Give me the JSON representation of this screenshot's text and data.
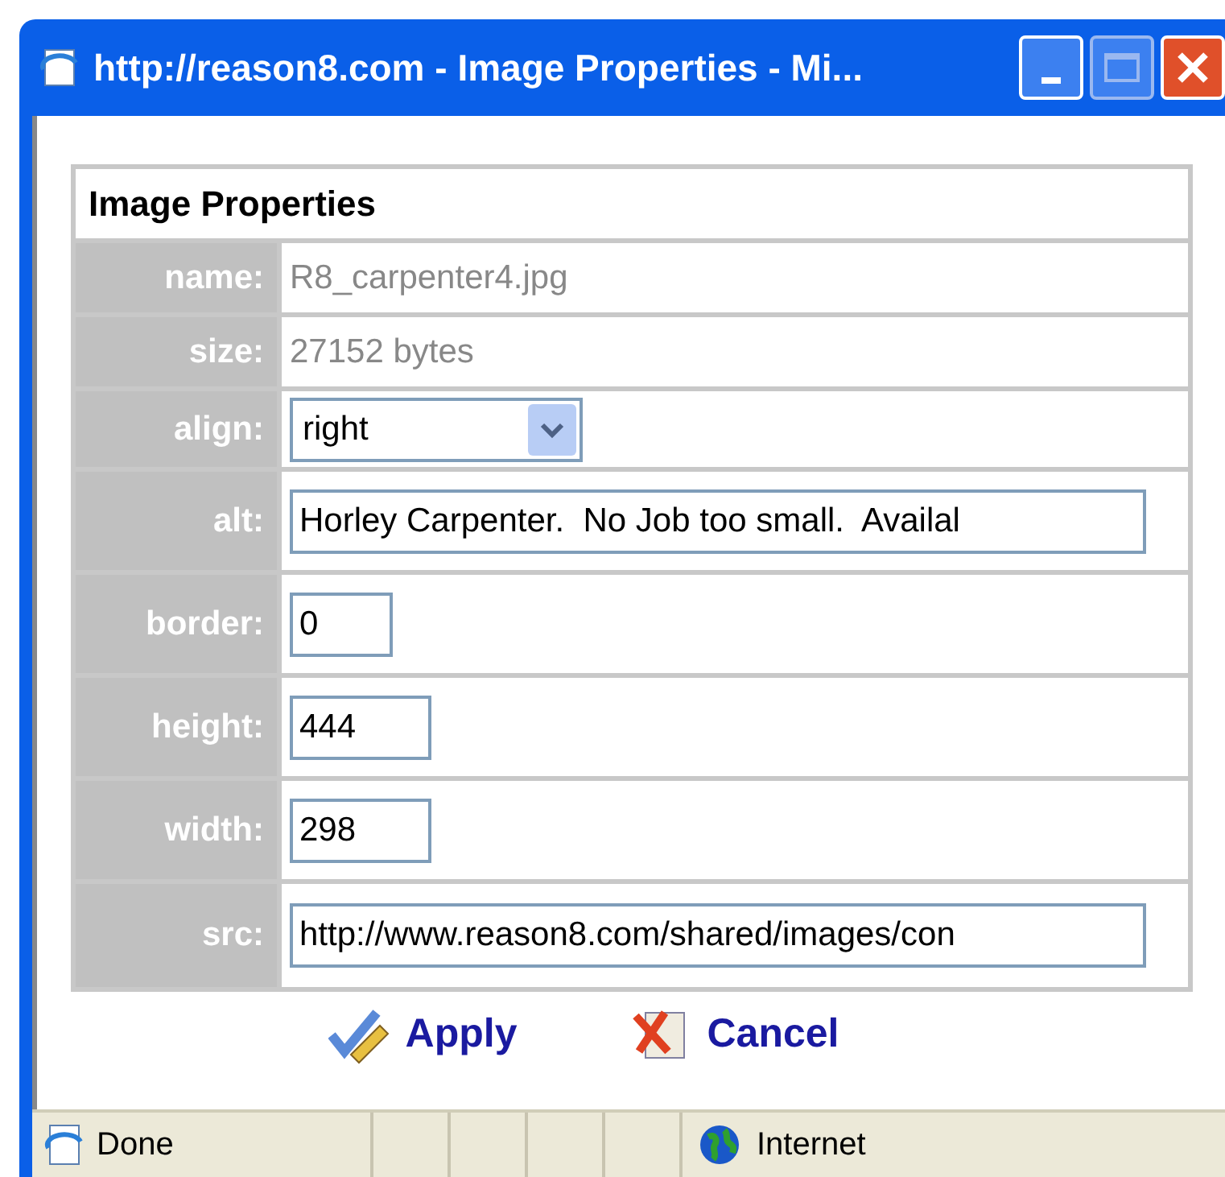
{
  "window": {
    "title": "http://reason8.com - Image Properties - Mi..."
  },
  "panel": {
    "title": "Image Properties",
    "rows": [
      {
        "label": "name:",
        "kind": "static",
        "value": "R8_carpenter4.jpg"
      },
      {
        "label": "size:",
        "kind": "static",
        "value": "27152 bytes"
      },
      {
        "label": "align:",
        "kind": "select",
        "value": "right"
      },
      {
        "label": "alt:",
        "kind": "input",
        "value": "Horley Carpenter.  No Job too small.  Availal"
      },
      {
        "label": "border:",
        "kind": "input",
        "value": "0"
      },
      {
        "label": "height:",
        "kind": "input",
        "value": "444"
      },
      {
        "label": "width:",
        "kind": "input",
        "value": "298"
      },
      {
        "label": "src:",
        "kind": "input",
        "value": "http://www.reason8.com/shared/images/con"
      }
    ]
  },
  "actions": [
    {
      "label": "Apply",
      "kind": "apply"
    },
    {
      "label": "Cancel",
      "kind": "cancel"
    }
  ],
  "status_bar": {
    "text": "Done",
    "zone": "Internet"
  }
}
